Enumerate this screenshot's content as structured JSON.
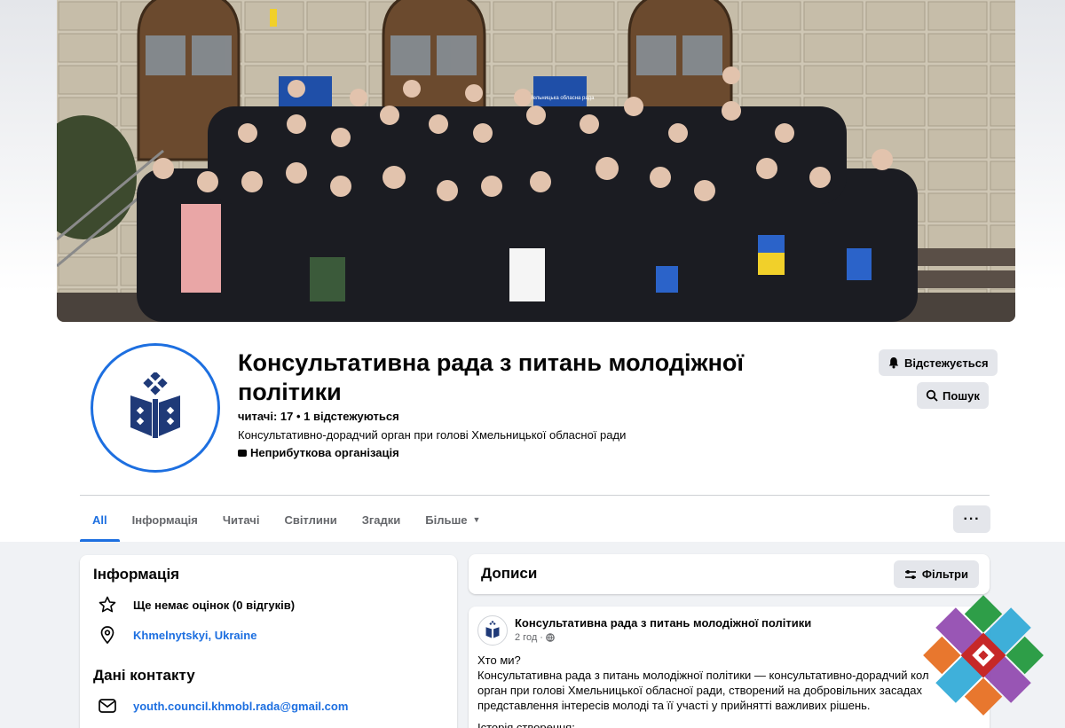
{
  "page": {
    "title": "Консультативна рада з питань молодіжної політики",
    "stats": "читачі: 17 • 1 відстежуються",
    "description": "Консультативно-дорадчий орган при голові Хмельницької обласної ради",
    "category": "Неприбуткова організація",
    "follow_button": "Відстежується",
    "search_button": "Пошук",
    "cover_signs": [
      "Хмельницька обласна рада",
      "Хмельницька обласна рада"
    ]
  },
  "tabs": [
    {
      "label": "All",
      "active": true
    },
    {
      "label": "Інформація",
      "active": false
    },
    {
      "label": "Читачі",
      "active": false
    },
    {
      "label": "Світлини",
      "active": false
    },
    {
      "label": "Згадки",
      "active": false
    },
    {
      "label": "Більше",
      "active": false,
      "dropdown": true
    }
  ],
  "more_button": "···",
  "info": {
    "heading": "Інформація",
    "rating": "Ще немає оцінок (0 відгуків)",
    "location": "Khmelnytskyi, Ukraine",
    "contact_heading": "Дані контакту",
    "email": "youth.council.khmobl.rada@gmail.com"
  },
  "posts": {
    "heading": "Дописи",
    "filters_button": "Фільтри"
  },
  "post": {
    "author": "Консультативна рада з питань молодіжної політики",
    "time": "2 год",
    "privacy_icon": "globe-icon",
    "lines": [
      "Хто ми?",
      "Консультативна рада з питань молодіжної політики — консультативно-дорадчий кол",
      "орган при голові Хмельницької обласної ради, створений на добровільних засадах",
      "представлення інтересів молоді та її участі у прийнятті важливих рішень.",
      "",
      "Історія створення:"
    ]
  },
  "colors": {
    "accent": "#1d6fe0",
    "button_bg": "#e4e6eb",
    "page_bg": "#f0f2f5",
    "logo_navy": "#1f3a78"
  },
  "icons": {
    "follow": "bell-icon",
    "search": "search-icon",
    "rating": "star-icon",
    "location": "map-pin-icon",
    "email": "mail-icon",
    "filters": "sliders-icon",
    "category": "category-icon"
  }
}
